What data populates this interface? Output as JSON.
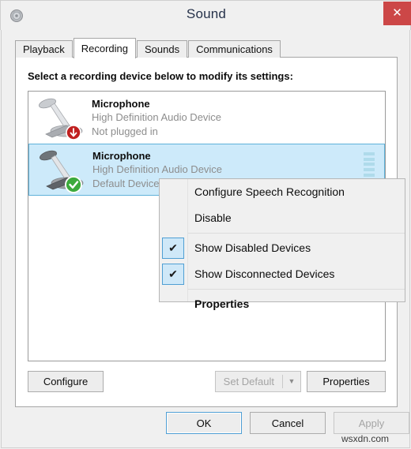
{
  "window": {
    "title": "Sound",
    "icon": "speaker-icon",
    "close_label": "✕"
  },
  "tabs": [
    {
      "label": "Playback",
      "active": false
    },
    {
      "label": "Recording",
      "active": true
    },
    {
      "label": "Sounds",
      "active": false
    },
    {
      "label": "Communications",
      "active": false
    }
  ],
  "recording": {
    "prompt": "Select a recording device below to modify its settings:",
    "devices": [
      {
        "name": "Microphone",
        "driver": "High Definition Audio Device",
        "status": "Not plugged in",
        "badge": "unplugged-badge",
        "selected": false,
        "has_meter": false
      },
      {
        "name": "Microphone",
        "driver": "High Definition Audio Device",
        "status": "Default Device",
        "badge": "default-check-badge",
        "selected": true,
        "has_meter": true
      }
    ],
    "buttons": {
      "configure": "Configure",
      "set_default": "Set Default",
      "set_default_enabled": false,
      "set_default_arrow": "▼",
      "properties": "Properties"
    }
  },
  "context_menu": {
    "items": [
      {
        "label": "Configure Speech Recognition",
        "checked": false,
        "bold": false,
        "separator_after": false
      },
      {
        "label": "Disable",
        "checked": false,
        "bold": false,
        "separator_after": true
      },
      {
        "label": "Show Disabled Devices",
        "checked": true,
        "bold": false,
        "separator_after": false
      },
      {
        "label": "Show Disconnected Devices",
        "checked": true,
        "bold": false,
        "separator_after": true
      },
      {
        "label": "Properties",
        "checked": false,
        "bold": true,
        "separator_after": false
      }
    ],
    "check_glyph": "✔"
  },
  "dialog_buttons": {
    "ok": "OK",
    "cancel": "Cancel",
    "apply": "Apply",
    "apply_enabled": false
  },
  "watermark": "wsxdn.com",
  "colors": {
    "selection": "#cdeafa",
    "selection_border": "#5fb2d9",
    "close_red": "#cc4747",
    "focus_blue": "#4f9fd4",
    "check_green": "#3caa3c",
    "badge_red": "#c02020",
    "disabled_text": "#a4a4a4",
    "sub_text": "#8d8d8d"
  }
}
